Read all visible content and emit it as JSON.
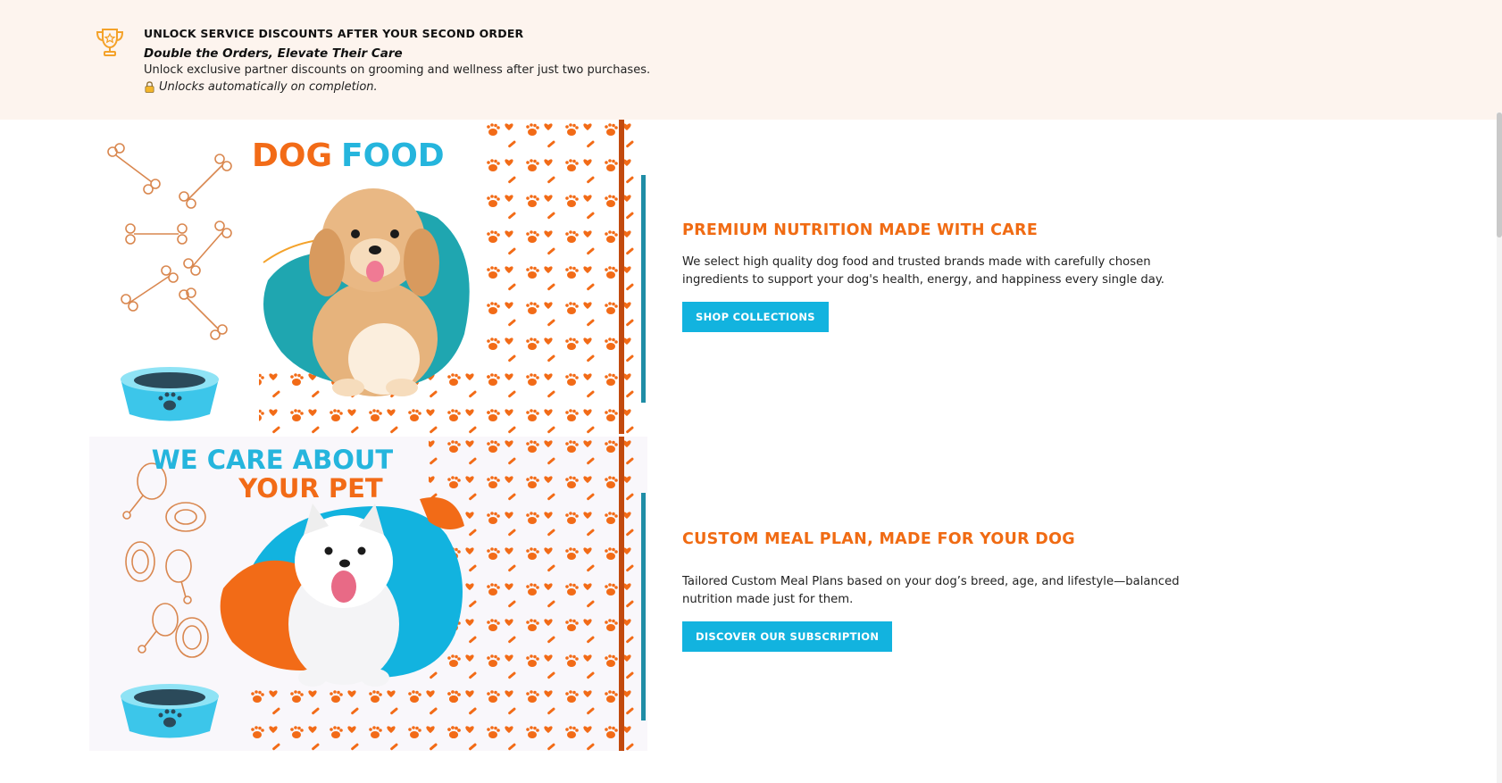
{
  "banner": {
    "title": "UNLOCK SERVICE DISCOUNTS AFTER YOUR SECOND ORDER",
    "subtitle": "Double the Orders, Elevate Their Care",
    "description": "Unlock exclusive partner discounts on grooming and wellness after just two purchases.",
    "note": "Unlocks automatically on completion.",
    "icon": "trophy-icon",
    "note_icon": "lock-icon"
  },
  "features": [
    {
      "image_heading_a": "DOG",
      "image_heading_b": "FOOD",
      "title": "PREMIUM NUTRITION MADE WITH CARE",
      "description": "We select high quality dog food and trusted brands made with carefully chosen ingredients to support your dog's health, energy, and happiness every single day.",
      "button": "SHOP COLLECTIONS"
    },
    {
      "image_heading_a": "WE CARE ABOUT",
      "image_heading_b": "YOUR PET",
      "title": "CUSTOM MEAL PLAN, MADE FOR YOUR DOG",
      "description": "Tailored Custom Meal Plans based on your dog’s breed, age, and lifestyle—balanced nutrition made just for them.",
      "button": "DISCOVER OUR SUBSCRIPTION"
    }
  ],
  "colors": {
    "accent_orange": "#f06b13",
    "accent_cyan": "#12b3df",
    "banner_bg": "#fdf4ee",
    "bar_teal": "#1f8da6"
  }
}
